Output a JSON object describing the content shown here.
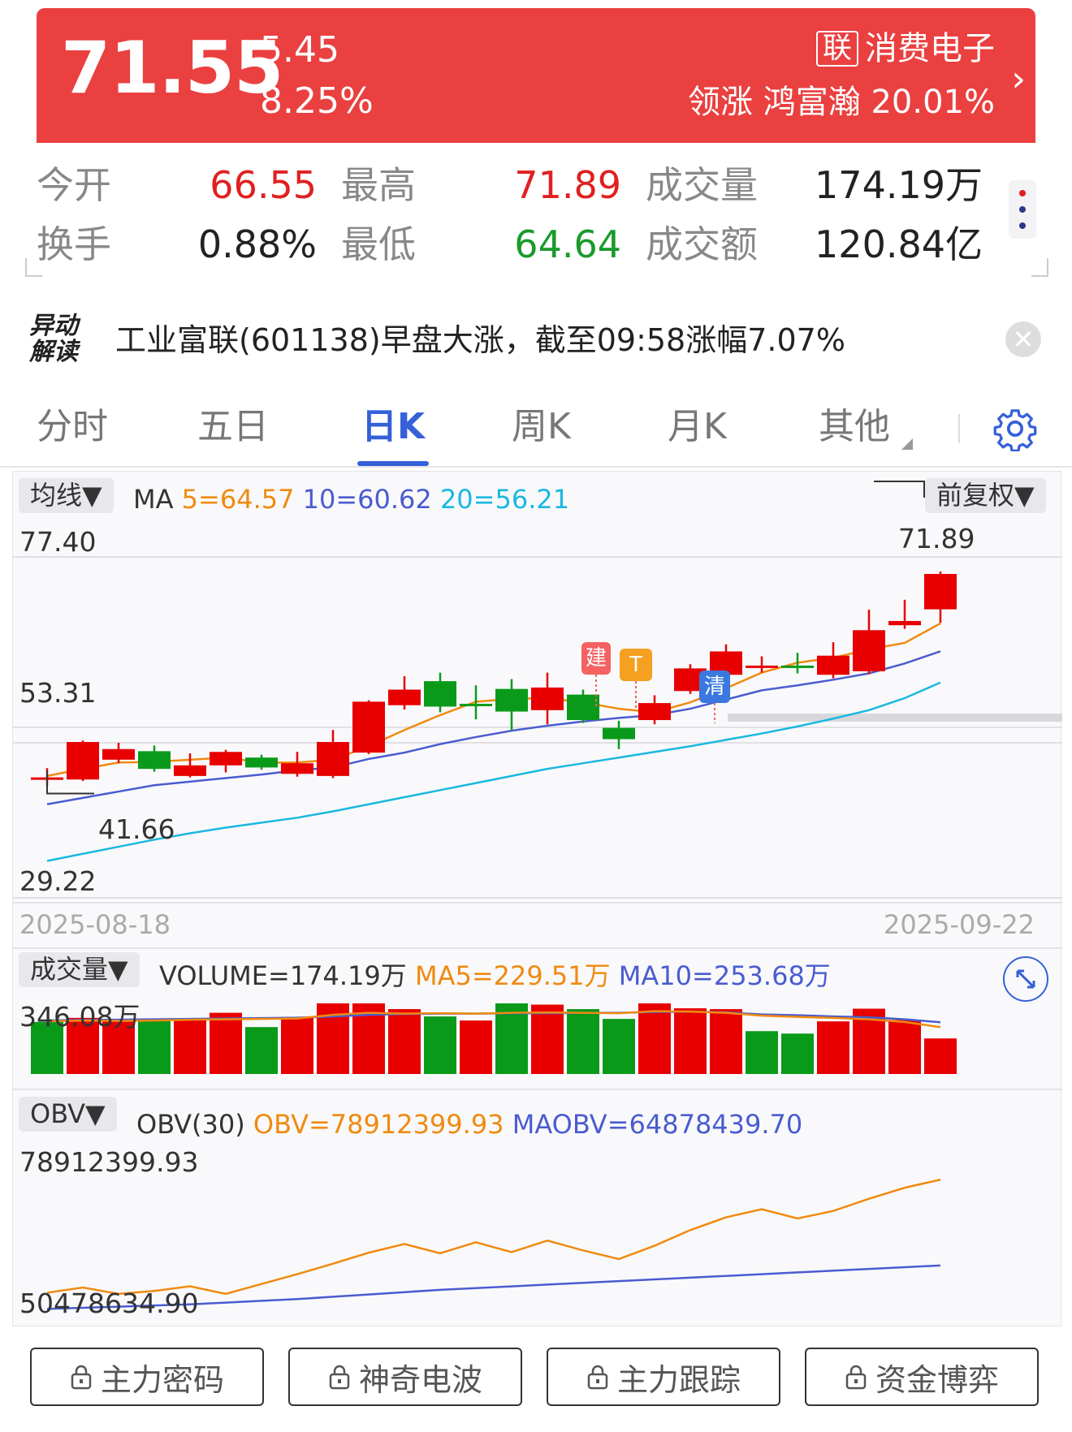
{
  "quote": {
    "price": "71.55",
    "change": "5.45",
    "change_pct": "8.25%",
    "sector_tag": "联",
    "sector_name": "消费电子",
    "sector_lead": "领涨 鸿富瀚 20.01%",
    "open_label": "今开",
    "open": "66.55",
    "high_label": "最高",
    "high": "71.89",
    "volume_label": "成交量",
    "volume": "174.19万",
    "turnover_label": "换手",
    "turnover": "0.88%",
    "low_label": "最低",
    "low": "64.64",
    "amount_label": "成交额",
    "amount": "120.84亿"
  },
  "news": {
    "badge_line1": "异动",
    "badge_line2": "解读",
    "text": "工业富联(601138)早盘大涨，截至09:58涨幅7.07%"
  },
  "tabs": [
    {
      "label": "分时"
    },
    {
      "label": "五日"
    },
    {
      "label": "日K"
    },
    {
      "label": "周K"
    },
    {
      "label": "月K"
    },
    {
      "label": "其他"
    }
  ],
  "active_tab": "日K",
  "kline": {
    "ma_button": "均线▼",
    "ma_prefix": "MA",
    "ma5": "5=64.57",
    "ma10": "10=60.62",
    "ma20": "20=56.21",
    "adjust_button": "前复权▼",
    "axis_top": "77.40",
    "axis_mid": "53.31",
    "axis_bottom": "29.22",
    "max_label": "71.89",
    "min_label": "41.66",
    "date_start": "2025-08-18",
    "date_end": "2025-09-22",
    "markers": {
      "build": "建",
      "t": "T",
      "clear": "清"
    }
  },
  "volume": {
    "button": "成交量▼",
    "volume_text": "VOLUME=174.19万",
    "ma5_text": "MA5=229.51万",
    "ma10_text": "MA10=253.68万",
    "axis_top": "346.08万"
  },
  "obv": {
    "button": "OBV▼",
    "title": "OBV(30)",
    "obv_text": "OBV=78912399.93",
    "maobv_text": "MAOBV=64878439.70",
    "axis_top": "78912399.93",
    "axis_bottom": "50478634.90"
  },
  "bottom_buttons": [
    {
      "label": "主力密码"
    },
    {
      "label": "神奇电波"
    },
    {
      "label": "主力跟踪"
    },
    {
      "label": "资金博弈"
    }
  ],
  "colors": {
    "up": "#e80000",
    "down": "#0a9a1a",
    "ma5": "#f08a10",
    "ma10": "#4a5cd0",
    "ma20": "#1ab8e0",
    "header": "#ea4040"
  },
  "chart_data": {
    "type": "candlestick",
    "ylim": [
      29.22,
      77.4
    ],
    "candles": [
      {
        "o": 42.8,
        "c": 42.8,
        "h": 44.1,
        "l": 41.66
      },
      {
        "o": 42.5,
        "c": 47.8,
        "h": 48.0,
        "l": 42.3
      },
      {
        "o": 45.3,
        "c": 46.8,
        "h": 47.7,
        "l": 44.8
      },
      {
        "o": 46.5,
        "c": 44.0,
        "h": 47.3,
        "l": 43.6
      },
      {
        "o": 43.0,
        "c": 44.5,
        "h": 46.2,
        "l": 42.8
      },
      {
        "o": 44.5,
        "c": 46.4,
        "h": 46.7,
        "l": 43.5
      },
      {
        "o": 45.6,
        "c": 44.2,
        "h": 46.0,
        "l": 43.9
      },
      {
        "o": 43.3,
        "c": 44.8,
        "h": 46.4,
        "l": 42.9
      },
      {
        "o": 43.0,
        "c": 47.8,
        "h": 49.5,
        "l": 42.7
      },
      {
        "o": 46.3,
        "c": 53.5,
        "h": 53.7,
        "l": 46.1
      },
      {
        "o": 53.0,
        "c": 55.2,
        "h": 57.1,
        "l": 52.4
      },
      {
        "o": 56.4,
        "c": 52.8,
        "h": 57.6,
        "l": 52.0
      },
      {
        "o": 53.2,
        "c": 53.0,
        "h": 55.8,
        "l": 51.0
      },
      {
        "o": 55.3,
        "c": 52.1,
        "h": 56.7,
        "l": 49.4
      },
      {
        "o": 52.3,
        "c": 55.5,
        "h": 57.6,
        "l": 50.3
      },
      {
        "o": 54.5,
        "c": 50.9,
        "h": 55.2,
        "l": 50.5
      },
      {
        "o": 49.8,
        "c": 48.2,
        "h": 50.8,
        "l": 46.8
      },
      {
        "o": 50.9,
        "c": 53.3,
        "h": 54.4,
        "l": 50.3
      },
      {
        "o": 55.0,
        "c": 58.2,
        "h": 58.8,
        "l": 54.6
      },
      {
        "o": 57.3,
        "c": 60.6,
        "h": 61.6,
        "l": 56.5
      },
      {
        "o": 58.6,
        "c": 58.6,
        "h": 59.9,
        "l": 57.6
      },
      {
        "o": 58.6,
        "c": 58.5,
        "h": 60.4,
        "l": 57.5
      },
      {
        "o": 57.3,
        "c": 60.0,
        "h": 61.9,
        "l": 56.8
      },
      {
        "o": 57.8,
        "c": 63.6,
        "h": 66.5,
        "l": 57.4
      },
      {
        "o": 64.3,
        "c": 64.9,
        "h": 67.9,
        "l": 63.8
      },
      {
        "o": 66.55,
        "c": 71.55,
        "h": 71.89,
        "l": 64.64
      }
    ],
    "ma5": [
      43.0,
      44.0,
      44.9,
      45.0,
      45.3,
      45.6,
      44.9,
      44.9,
      45.3,
      47.2,
      49.5,
      51.6,
      53.5,
      53.9,
      54.0,
      53.4,
      52.5,
      52.0,
      53.4,
      55.4,
      57.6,
      59.0,
      59.7,
      60.9,
      61.8,
      64.57
    ],
    "ma10": [
      39.0,
      39.9,
      40.8,
      41.7,
      42.2,
      42.7,
      43.2,
      43.8,
      44.2,
      45.4,
      46.3,
      47.5,
      48.5,
      49.4,
      50.1,
      50.7,
      51.2,
      51.6,
      52.5,
      53.8,
      55.1,
      55.8,
      56.6,
      57.5,
      58.9,
      60.62
    ],
    "ma20": [
      31.0,
      32.0,
      33.0,
      34.0,
      34.9,
      35.7,
      36.4,
      37.1,
      38.0,
      39.0,
      40.0,
      41.0,
      42.0,
      43.0,
      44.0,
      44.8,
      45.6,
      46.4,
      47.2,
      48.1,
      49.0,
      50.0,
      51.1,
      52.3,
      54.0,
      56.21
    ],
    "volume": {
      "ylim": [
        0,
        346.08
      ],
      "values": [
        255,
        275,
        260,
        265,
        265,
        300,
        230,
        275,
        346,
        346,
        318,
        282,
        262,
        346,
        340,
        318,
        270,
        346,
        322,
        318,
        210,
        198,
        258,
        320,
        265,
        174.19
      ],
      "up": [
        false,
        true,
        true,
        false,
        true,
        true,
        false,
        true,
        true,
        true,
        true,
        false,
        true,
        false,
        true,
        false,
        false,
        true,
        true,
        true,
        false,
        false,
        true,
        true,
        true,
        true
      ],
      "ma5": [
        258,
        262,
        260,
        262,
        266,
        268,
        270,
        272,
        290,
        300,
        296,
        298,
        296,
        300,
        302,
        300,
        298,
        308,
        306,
        300,
        286,
        280,
        275,
        268,
        255,
        229.51
      ],
      "ma10": [
        262,
        265,
        266,
        268,
        270,
        272,
        274,
        276,
        282,
        290,
        294,
        296,
        296,
        298,
        298,
        300,
        300,
        304,
        306,
        302,
        292,
        288,
        282,
        278,
        268,
        253.68
      ]
    },
    "obv": {
      "obv": [
        52,
        52.9,
        51.8,
        52.3,
        53.1,
        51.8,
        53.5,
        55.2,
        57.0,
        58.9,
        60.4,
        58.8,
        60.7,
        59.0,
        61.0,
        59.3,
        57.8,
        60.1,
        62.8,
        65.0,
        66.4,
        64.8,
        66.1,
        68.2,
        70.1,
        71.5
      ],
      "maobv": [
        49.2,
        49.4,
        49.6,
        49.8,
        50.0,
        50.3,
        50.6,
        50.9,
        51.3,
        51.7,
        52.1,
        52.5,
        52.8,
        53.1,
        53.4,
        53.7,
        54.0,
        54.3,
        54.6,
        54.9,
        55.2,
        55.5,
        55.8,
        56.1,
        56.4,
        56.7
      ],
      "ylim": [
        48.0,
        76.0
      ]
    }
  }
}
